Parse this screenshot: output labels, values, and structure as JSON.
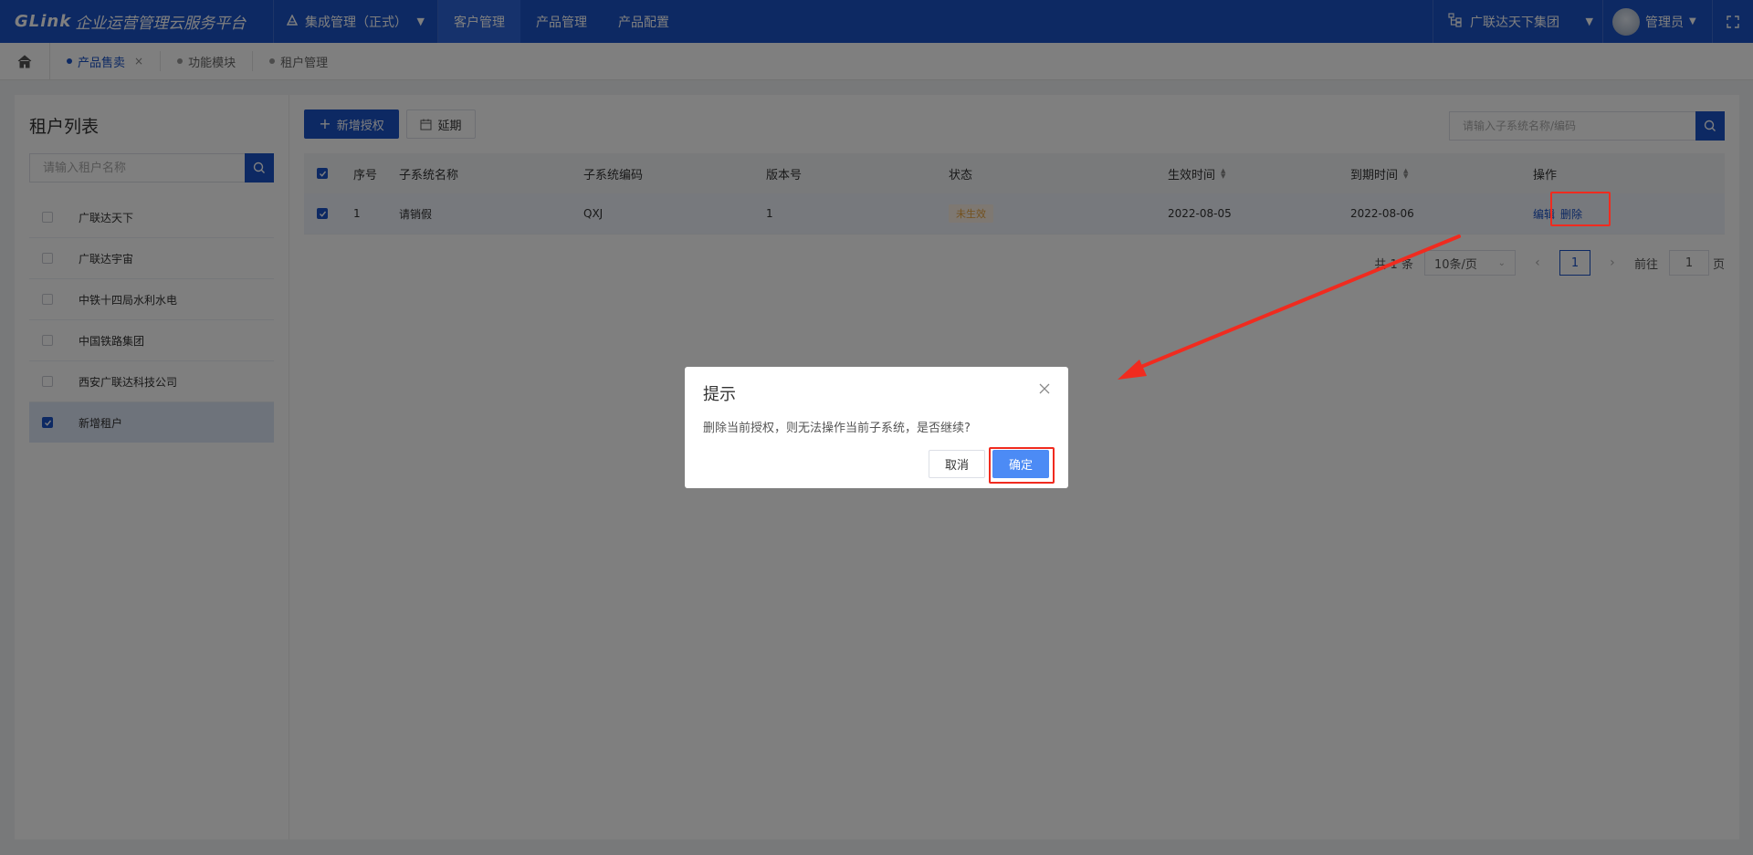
{
  "header": {
    "brand": "GLink",
    "app_title": "企业运营管理云服务平台",
    "system": "集成管理（正式）",
    "nav": [
      "客户管理",
      "产品管理",
      "产品配置"
    ],
    "active_nav": "客户管理",
    "organization": "广联达天下集团",
    "user": "管理员"
  },
  "tabs": [
    {
      "label": "产品售卖",
      "active": true,
      "closable": true
    },
    {
      "label": "功能模块",
      "active": false
    },
    {
      "label": "租户管理",
      "active": false
    }
  ],
  "tenant_panel": {
    "title": "租户列表",
    "search_placeholder": "请输入租户名称",
    "items": [
      {
        "name": "广联达天下",
        "checked": false
      },
      {
        "name": "广联达宇宙",
        "checked": false
      },
      {
        "name": "中铁十四局水利水电",
        "checked": false
      },
      {
        "name": "中国铁路集团",
        "checked": false
      },
      {
        "name": "西安广联达科技公司",
        "checked": false
      },
      {
        "name": "新增租户",
        "checked": true
      }
    ]
  },
  "toolbar": {
    "add_label": "新增授权",
    "extend_label": "延期",
    "search_placeholder": "请输入子系统名称/编码"
  },
  "table": {
    "columns": [
      "序号",
      "子系统名称",
      "子系统编码",
      "版本号",
      "状态",
      "生效时间",
      "到期时间",
      "操作"
    ],
    "rows": [
      {
        "index": "1",
        "name": "请销假",
        "code": "QXJ",
        "version": "1",
        "status": "未生效",
        "start": "2022-08-05",
        "end": "2022-08-06",
        "actions": [
          "编辑",
          "删除"
        ],
        "checked": true
      }
    ]
  },
  "pagination": {
    "total_text": "共 1 条",
    "page_size": "10条/页",
    "current_page": "1",
    "goto_label": "前往",
    "goto_value": "1",
    "page_unit": "页"
  },
  "dialog": {
    "title": "提示",
    "message": "删除当前授权，则无法操作当前子系统，是否继续?",
    "cancel_label": "取消",
    "confirm_label": "确定"
  },
  "colors": {
    "primary": "#1a52c7",
    "annotation": "#f02b1f",
    "pending": "#e6a23c"
  }
}
